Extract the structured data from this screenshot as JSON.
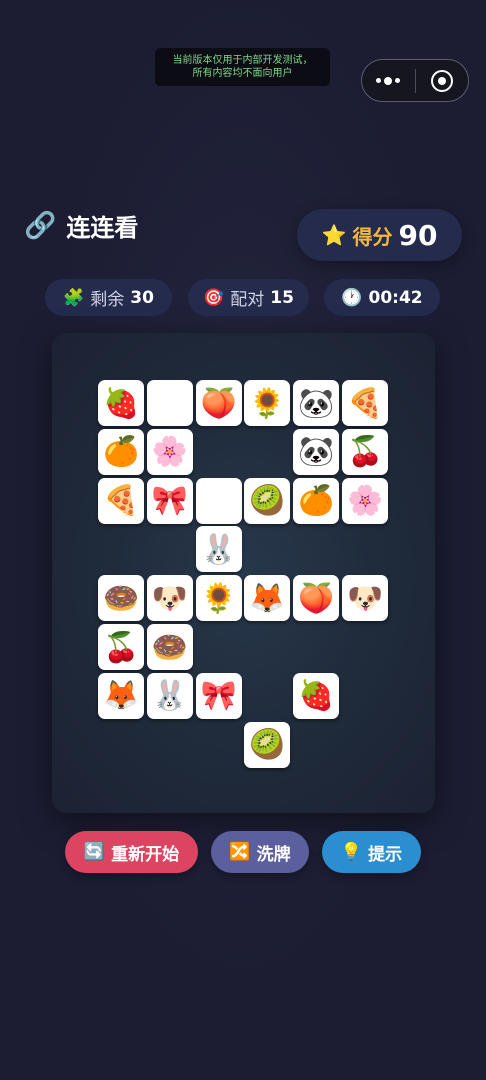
{
  "dev_notice": {
    "line1": "当前版本仅用于内部开发测试，",
    "line2": "所有内容均不面向用户"
  },
  "header": {
    "icon": "🔗",
    "title": "连连看"
  },
  "score": {
    "icon": "⭐",
    "label": "得分",
    "value": "90"
  },
  "stats": {
    "remaining": {
      "icon": "🧩",
      "label": "剩余",
      "value": "30"
    },
    "pairs": {
      "icon": "🎯",
      "label": "配对",
      "value": "15"
    },
    "timer": {
      "icon": "🕐",
      "value": "00:42"
    }
  },
  "board": {
    "rows": [
      [
        "🍓",
        "🐱",
        "🍑",
        "🌻",
        "🐼",
        "🍕"
      ],
      [
        "🍊",
        "🌸",
        "",
        "",
        "🐼",
        "🍒"
      ],
      [
        "🍕",
        "🎀",
        "🐱",
        "🥝",
        "🍊",
        "🌸"
      ],
      [
        "",
        "",
        "🐰",
        "",
        "",
        ""
      ],
      [
        "🍩",
        "🐶",
        "🌻",
        "🦊",
        "🍑",
        "🐶"
      ],
      [
        "🍒",
        "🍩",
        "",
        "",
        "",
        ""
      ],
      [
        "🦊",
        "🐰",
        "🎀",
        "",
        "🍓",
        ""
      ],
      [
        "",
        "",
        "",
        "🥝",
        "",
        ""
      ]
    ]
  },
  "buttons": {
    "restart": {
      "icon": "🔄",
      "label": "重新开始"
    },
    "shuffle": {
      "icon": "🔀",
      "label": "洗牌"
    },
    "hint": {
      "icon": "💡",
      "label": "提示"
    }
  },
  "colors": {
    "restart": "#dc4462",
    "shuffle": "#5b5f9e",
    "hint": "#2b8ed0",
    "accent": "#f4b740"
  }
}
